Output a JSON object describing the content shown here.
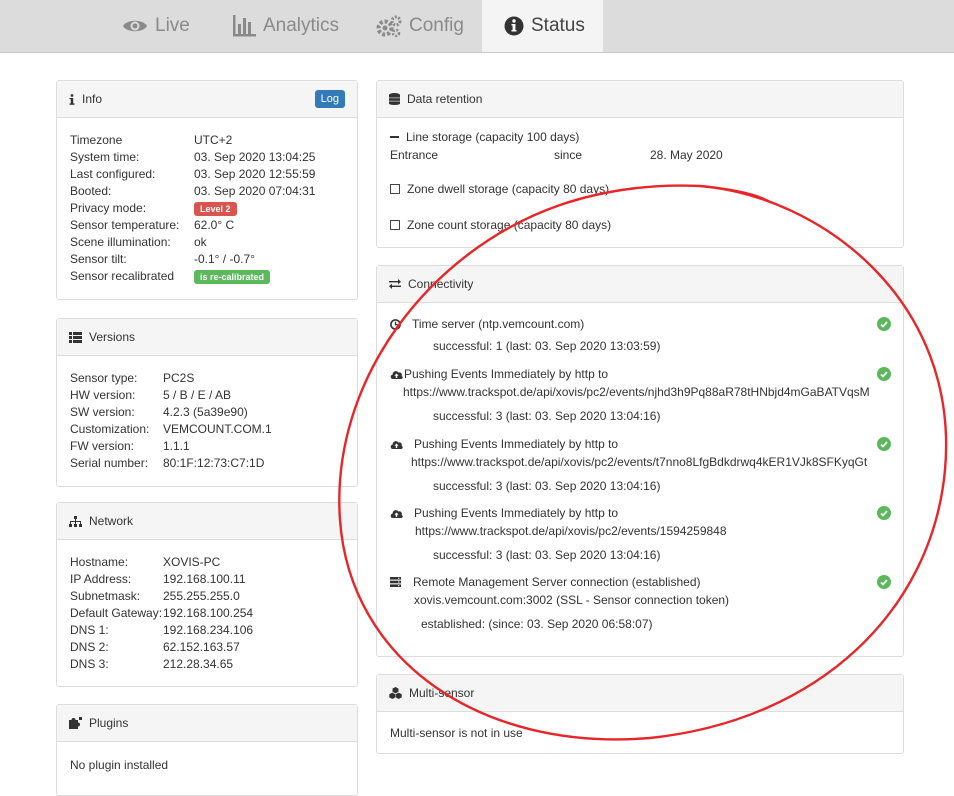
{
  "tabs": [
    {
      "label": "Live",
      "icon": "eye-icon"
    },
    {
      "label": "Analytics",
      "icon": "bar-chart-icon"
    },
    {
      "label": "Config",
      "icon": "gears-icon"
    },
    {
      "label": "Status",
      "icon": "info-circle-icon"
    }
  ],
  "info": {
    "title": "Info",
    "log_button": "Log",
    "rows": [
      {
        "label": "Timezone",
        "value": "UTC+2"
      },
      {
        "label": "System time:",
        "value": "03. Sep 2020 13:04:25"
      },
      {
        "label": "Last configured:",
        "value": "03. Sep 2020 12:55:59"
      },
      {
        "label": "Booted:",
        "value": "03. Sep 2020 07:04:31"
      },
      {
        "label": "Privacy mode:",
        "value": "Level 2"
      },
      {
        "label": "Sensor temperature:",
        "value": "62.0° C"
      },
      {
        "label": "Scene illumination:",
        "value": "ok"
      },
      {
        "label": "Sensor tilt:",
        "value": "-0.1° / -0.7°"
      },
      {
        "label": "Sensor recalibrated",
        "value": "is re-calibrated"
      }
    ],
    "colors": {
      "privacy_badge": "#d9534f",
      "recalibrated_badge": "#5cb85c"
    }
  },
  "versions": {
    "title": "Versions",
    "rows": [
      {
        "label": "Sensor type:",
        "value": "PC2S"
      },
      {
        "label": "HW version:",
        "value": "5 / B / E / AB"
      },
      {
        "label": "SW version:",
        "value": "4.2.3 (5a39e90)"
      },
      {
        "label": "Customization:",
        "value": "VEMCOUNT.COM.1"
      },
      {
        "label": "FW version:",
        "value": "1.1.1"
      },
      {
        "label": "Serial number:",
        "value": "80:1F:12:73:C7:1D"
      }
    ]
  },
  "network": {
    "title": "Network",
    "rows": [
      {
        "label": "Hostname:",
        "value": "XOVIS-PC"
      },
      {
        "label": "IP Address:",
        "value": "192.168.100.11"
      },
      {
        "label": "Subnetmask:",
        "value": "255.255.255.0"
      },
      {
        "label": "Default Gateway:",
        "value": "192.168.100.254"
      },
      {
        "label": "DNS 1:",
        "value": "192.168.234.106"
      },
      {
        "label": "DNS 2:",
        "value": "62.152.163.57"
      },
      {
        "label": "DNS 3:",
        "value": "212.28.34.65"
      }
    ]
  },
  "plugins": {
    "title": "Plugins",
    "text": "No plugin installed"
  },
  "retention": {
    "title": "Data retention",
    "line_storage": "Line storage (capacity 100 days)",
    "entrance_label": "Entrance",
    "since_label": "since",
    "since_date": "28. May 2020",
    "zone_dwell": "Zone dwell storage (capacity 80 days)",
    "zone_count": "Zone count storage (capacity 80 days)"
  },
  "connectivity": {
    "title": "Connectivity",
    "items": [
      {
        "title": "Time server (ntp.vemcount.com)",
        "url": "",
        "status": "successful:  1  (last: 03. Sep 2020 13:03:59)",
        "icon": "clock-icon"
      },
      {
        "title": "Pushing Events Immediately by http to",
        "url": "https://www.trackspot.de/api/xovis/pc2/events/njhd3h9Pq88aR78tHNbjd4mGaBATVqsM",
        "status": "successful:  3  (last: 03. Sep 2020 13:04:16)",
        "icon": "cloud-upload-icon"
      },
      {
        "title": "Pushing Events Immediately by http to",
        "url": "https://www.trackspot.de/api/xovis/pc2/events/t7nno8LfgBdkdrwq4kER1VJk8SFKyqGt",
        "status": "successful:  3  (last: 03. Sep 2020 13:04:16)",
        "icon": "cloud-upload-icon"
      },
      {
        "title": "Pushing Events Immediately by http to",
        "url": "https://www.trackspot.de/api/xovis/pc2/events/1594259848",
        "status": "successful:  3  (last: 03. Sep 2020 13:04:16)",
        "icon": "cloud-upload-icon"
      },
      {
        "title": "Remote Management Server connection (established)",
        "url": "xovis.vemcount.com:3002 (SSL - Sensor connection token)",
        "status": "established:  (since: 03. Sep 2020 06:58:07)",
        "icon": "server-icon"
      }
    ],
    "check_color": "#5cb85c"
  },
  "multisensor": {
    "title": "Multi-sensor",
    "text": "Multi-sensor is not in use"
  },
  "annotation": {
    "color": "#e8262a"
  }
}
